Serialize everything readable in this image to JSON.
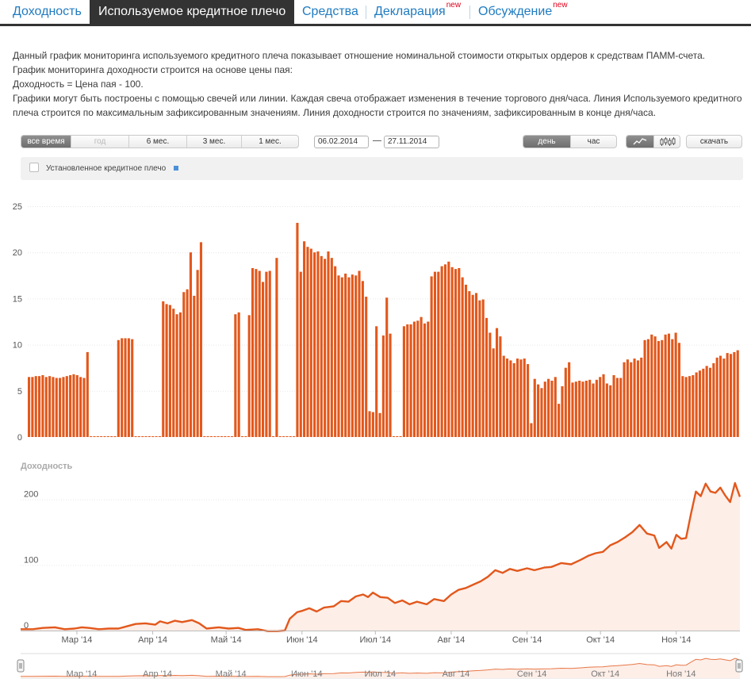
{
  "tabs": [
    {
      "label": "Доходность",
      "badge": ""
    },
    {
      "label": "Используемое кредитное плечо",
      "badge": ""
    },
    {
      "label": "Средства",
      "badge": ""
    },
    {
      "label": "Декларация",
      "badge": "new"
    },
    {
      "label": "Обсуждение",
      "badge": "new"
    }
  ],
  "description": [
    "Данный график мониторинга используемого кредитного плеча показывает отношение номинальной стоимости открытых ордеров к средствам ПАММ-счета.",
    "График мониторинга доходности строится на основе цены пая:",
    "Доходность = Цена пая - 100.",
    "Графики могут быть построены с помощью свечей или линии. Каждая свеча отображает изменения в течение торгового дня/часа. Линия Используемого кредитного плеча строится по максимальным зафиксированным значениям. Линия доходности строится по значениям, зафиксированным в конце дня/часа."
  ],
  "controls": {
    "periods": [
      "все время",
      "год",
      "6 мес.",
      "3 мес.",
      "1 мес."
    ],
    "date_from": "06.02.2014",
    "date_to": "27.11.2014",
    "granularity": [
      "день",
      "час"
    ],
    "download": "скачать",
    "overlay_label": "Установленное кредитное плечо"
  },
  "colors": {
    "bar": "#e2581c",
    "line": "#e2581c",
    "area": "#fdeee8",
    "overlay": "#4a90d9"
  },
  "chart_data": [
    {
      "type": "bar",
      "title": "",
      "ylim": [
        0,
        25
      ],
      "yticks": [
        0,
        5,
        10,
        15,
        20,
        25
      ],
      "grid": true,
      "values": [
        6.5,
        6.5,
        6.6,
        6.6,
        6.7,
        6.5,
        6.6,
        6.5,
        6.4,
        6.4,
        6.5,
        6.6,
        6.7,
        6.8,
        6.7,
        6.5,
        6.4,
        9.2,
        0,
        0,
        0,
        0,
        0,
        0,
        0,
        0,
        10.5,
        10.7,
        10.7,
        10.7,
        10.6,
        0,
        0,
        0,
        0,
        0,
        0,
        0,
        0,
        14.7,
        14.4,
        14.3,
        13.9,
        13.3,
        13.5,
        15.7,
        16.0,
        20.0,
        15.3,
        18.1,
        21.1,
        0,
        0,
        0,
        0,
        0,
        0,
        0,
        0,
        0,
        13.3,
        13.5,
        0,
        0,
        13.2,
        18.3,
        18.2,
        18.0,
        16.8,
        17.9,
        18.0,
        0,
        19.4,
        0,
        0,
        0,
        0,
        0,
        23.2,
        17.9,
        21.2,
        20.6,
        20.4,
        20.0,
        20.1,
        19.6,
        19.3,
        20.1,
        19.4,
        18.5,
        17.5,
        17.3,
        17.7,
        17.3,
        17.6,
        17.5,
        18.0,
        16.9,
        15.2,
        2.8,
        2.7,
        12.0,
        2.6,
        11.0,
        15.1,
        11.2,
        0,
        0,
        0,
        12.0,
        12.2,
        12.2,
        12.5,
        12.6,
        13.0,
        12.3,
        12.5,
        17.4,
        17.9,
        17.9,
        18.5,
        18.7,
        19.0,
        18.4,
        18.2,
        18.3,
        17.3,
        16.5,
        15.8,
        15.4,
        15.6,
        14.8,
        14.9,
        12.9,
        11.3,
        9.6,
        11.8,
        10.9,
        8.8,
        8.5,
        8.3,
        8.0,
        8.5,
        8.4,
        8.5,
        7.9,
        1.5,
        6.3,
        5.7,
        5.3,
        6.0,
        6.3,
        6.1,
        6.5,
        3.6,
        5.5,
        7.5,
        8.1,
        5.9,
        6.0,
        6.1,
        6.0,
        6.1,
        6.2,
        5.8,
        6.2,
        6.5,
        6.8,
        5.8,
        5.6,
        6.7,
        6.4,
        6.4,
        8.1,
        8.4,
        8.1,
        8.5,
        8.3,
        8.6,
        10.5,
        10.6,
        11.1,
        10.9,
        10.4,
        10.5,
        11.1,
        11.2,
        10.6,
        11.3,
        10.2,
        6.6,
        6.5,
        6.6,
        6.7,
        7.0,
        7.2,
        7.4,
        7.7,
        7.5,
        8.0,
        8.6,
        8.8,
        8.5,
        9.1,
        9.0,
        9.2,
        9.4
      ]
    },
    {
      "type": "area",
      "title": "Доходность",
      "ylim": [
        0,
        225
      ],
      "yticks": [
        0,
        100,
        200
      ],
      "xticks": [
        "Мар '14",
        "Апр '14",
        "Май '14",
        "Июн '14",
        "Июл '14",
        "Авг '14",
        "Сен '14",
        "Окт '14",
        "Ноя '14"
      ],
      "x_start": "2014-02-06",
      "x_end": "2014-11-27",
      "points": [
        [
          "2014-02-06",
          2
        ],
        [
          "2014-02-11",
          2
        ],
        [
          "2014-02-15",
          4
        ],
        [
          "2014-02-20",
          5
        ],
        [
          "2014-02-24",
          2
        ],
        [
          "2014-02-28",
          3
        ],
        [
          "2014-03-03",
          5
        ],
        [
          "2014-03-06",
          4
        ],
        [
          "2014-03-10",
          2
        ],
        [
          "2014-03-14",
          3
        ],
        [
          "2014-03-18",
          3
        ],
        [
          "2014-03-22",
          7
        ],
        [
          "2014-03-25",
          10
        ],
        [
          "2014-03-29",
          11
        ],
        [
          "2014-04-02",
          9
        ],
        [
          "2014-04-04",
          14
        ],
        [
          "2014-04-07",
          11
        ],
        [
          "2014-04-10",
          15
        ],
        [
          "2014-04-13",
          13
        ],
        [
          "2014-04-17",
          16
        ],
        [
          "2014-04-20",
          11
        ],
        [
          "2014-04-23",
          3
        ],
        [
          "2014-04-28",
          5
        ],
        [
          "2014-05-02",
          3
        ],
        [
          "2014-05-06",
          4
        ],
        [
          "2014-05-09",
          1
        ],
        [
          "2014-05-14",
          2
        ],
        [
          "2014-05-18",
          -1
        ],
        [
          "2014-05-22",
          -1
        ],
        [
          "2014-05-25",
          0
        ],
        [
          "2014-05-27",
          18
        ],
        [
          "2014-05-30",
          28
        ],
        [
          "2014-06-01",
          30
        ],
        [
          "2014-06-04",
          34
        ],
        [
          "2014-06-07",
          29
        ],
        [
          "2014-06-10",
          35
        ],
        [
          "2014-06-14",
          37
        ],
        [
          "2014-06-17",
          45
        ],
        [
          "2014-06-20",
          44
        ],
        [
          "2014-06-23",
          52
        ],
        [
          "2014-06-26",
          55
        ],
        [
          "2014-06-28",
          51
        ],
        [
          "2014-06-30",
          58
        ],
        [
          "2014-07-03",
          51
        ],
        [
          "2014-07-06",
          50
        ],
        [
          "2014-07-09",
          42
        ],
        [
          "2014-07-12",
          46
        ],
        [
          "2014-07-15",
          40
        ],
        [
          "2014-07-18",
          44
        ],
        [
          "2014-07-22",
          40
        ],
        [
          "2014-07-25",
          48
        ],
        [
          "2014-07-29",
          45
        ],
        [
          "2014-08-01",
          55
        ],
        [
          "2014-08-04",
          62
        ],
        [
          "2014-08-07",
          65
        ],
        [
          "2014-08-10",
          70
        ],
        [
          "2014-08-13",
          75
        ],
        [
          "2014-08-16",
          82
        ],
        [
          "2014-08-19",
          92
        ],
        [
          "2014-08-22",
          88
        ],
        [
          "2014-08-25",
          94
        ],
        [
          "2014-08-28",
          91
        ],
        [
          "2014-09-01",
          95
        ],
        [
          "2014-09-04",
          92
        ],
        [
          "2014-09-08",
          96
        ],
        [
          "2014-09-11",
          97
        ],
        [
          "2014-09-15",
          103
        ],
        [
          "2014-09-19",
          101
        ],
        [
          "2014-09-23",
          108
        ],
        [
          "2014-09-26",
          114
        ],
        [
          "2014-09-29",
          118
        ],
        [
          "2014-10-02",
          120
        ],
        [
          "2014-10-05",
          130
        ],
        [
          "2014-10-08",
          135
        ],
        [
          "2014-10-11",
          142
        ],
        [
          "2014-10-14",
          150
        ],
        [
          "2014-10-17",
          161
        ],
        [
          "2014-10-20",
          148
        ],
        [
          "2014-10-23",
          145
        ],
        [
          "2014-10-25",
          126
        ],
        [
          "2014-10-28",
          135
        ],
        [
          "2014-10-30",
          125
        ],
        [
          "2014-11-01",
          146
        ],
        [
          "2014-11-03",
          140
        ],
        [
          "2014-11-05",
          141
        ],
        [
          "2014-11-07",
          178
        ],
        [
          "2014-11-09",
          212
        ],
        [
          "2014-11-11",
          205
        ],
        [
          "2014-11-13",
          224
        ],
        [
          "2014-11-15",
          212
        ],
        [
          "2014-11-17",
          210
        ],
        [
          "2014-11-19",
          218
        ],
        [
          "2014-11-21",
          206
        ],
        [
          "2014-11-23",
          196
        ],
        [
          "2014-11-25",
          225
        ],
        [
          "2014-11-27",
          204
        ]
      ]
    }
  ]
}
